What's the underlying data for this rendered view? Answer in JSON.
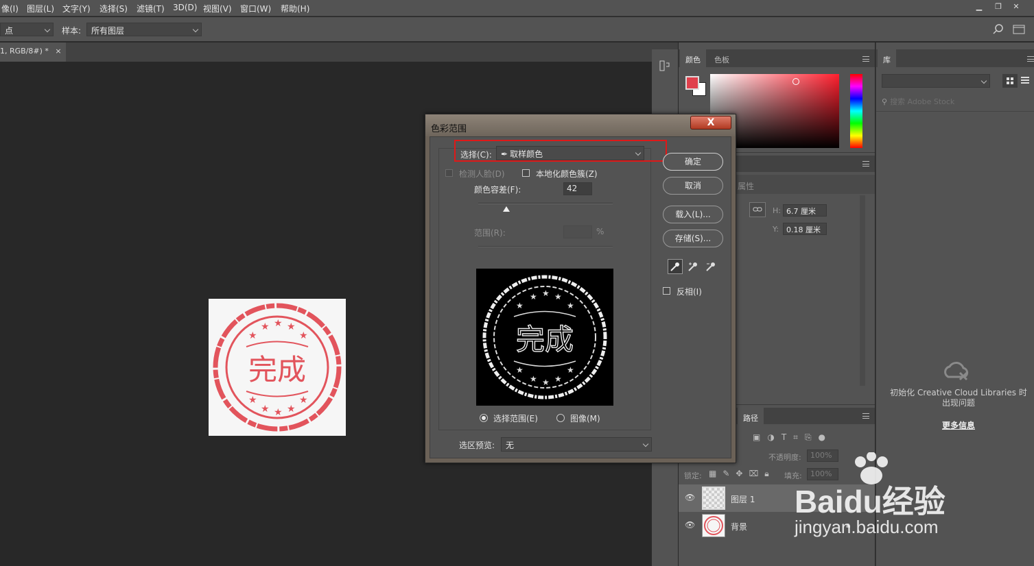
{
  "menu": [
    "像(I)",
    "图层(L)",
    "文字(Y)",
    "选择(S)",
    "滤镜(T)",
    "3D(D)",
    "视图(V)",
    "窗口(W)",
    "帮助(H)"
  ],
  "options_bar": {
    "sample_size_value": "点",
    "sample_label": "样本:",
    "sample_value": "所有图层"
  },
  "document_tab": {
    "title": "1, RGB/8#) *",
    "close": "×"
  },
  "stamp": {
    "text": "完成"
  },
  "color_panel": {
    "tab_color": "颜色",
    "tab_swatches": "色板",
    "foreground_color": "#e0404c"
  },
  "library_panel": {
    "tab": "库",
    "search_placeholder": "搜索 Adobe Stock",
    "message": "初始化 Creative Cloud Libraries 时出现问题",
    "more_info": "更多信息"
  },
  "properties_panel": {
    "tab": "属性",
    "h_label": "H:",
    "h_value": "6.7 厘米",
    "y_label": "Y:",
    "y_value": "0.18 厘米"
  },
  "layers_panel": {
    "tab_paths": "路径",
    "opacity_label": "不透明度:",
    "opacity_value": "100%",
    "lock_label": "锁定:",
    "fill_label": "填充:",
    "fill_value": "100%",
    "layers": [
      {
        "name": "图层 1",
        "selected": true
      },
      {
        "name": "背景",
        "selected": false
      }
    ]
  },
  "dialog": {
    "title": "色彩范围",
    "close": "X",
    "select_label": "选择(C):",
    "select_value": "取样颜色",
    "detect_faces": "检测人脸(D)",
    "localized_clusters": "本地化颜色簇(Z)",
    "fuzziness_label": "颜色容差(F):",
    "fuzziness_value": "42",
    "fuzziness": 0.21,
    "range_label": "范围(R):",
    "range_unit": "%",
    "preview_stamp_text": "完成",
    "radio_selection": "选择范围(E)",
    "radio_image": "图像(M)",
    "preview_label": "选区预览:",
    "preview_value": "无",
    "ok": "确定",
    "cancel": "取消",
    "load": "载入(L)...",
    "save": "存储(S)...",
    "invert": "反相(I)"
  },
  "watermark": {
    "brand": "Baidu经验",
    "url": "jingyan.baidu.com"
  }
}
